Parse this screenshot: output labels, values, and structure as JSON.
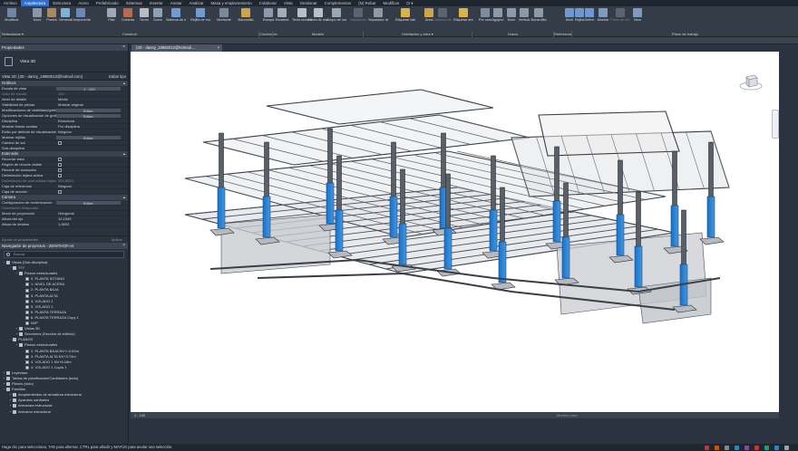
{
  "menu": {
    "tabs": [
      "Archivo",
      "Arquitectura",
      "Estructura",
      "Acero",
      "Prefabricado",
      "Sistemas",
      "Insertar",
      "Anotar",
      "Analizar",
      "Masa y emplazamiento",
      "Colaborar",
      "Vista",
      "Gestionar",
      "Complementos",
      "(N) Rebar",
      "Modificar"
    ],
    "active_index": 1
  },
  "ribbon": {
    "buttons": [
      {
        "label": "Modificar",
        "color": "#6f86a6",
        "dim": false
      },
      {
        "label": "Muro",
        "color": "#8a97a8",
        "dim": false
      },
      {
        "label": "Puerta",
        "color": "#a88a5e",
        "dim": false
      },
      {
        "label": "Ventana",
        "color": "#7fb0d6",
        "dim": false
      },
      {
        "label": "Componente",
        "color": "#6e87b9",
        "dim": false
      },
      {
        "label": "Pilar",
        "color": "#9fa8b6",
        "dim": false
      },
      {
        "label": "Cubierta",
        "color": "#b86b4b",
        "dim": false
      },
      {
        "label": "Techo",
        "color": "#b5bcc6",
        "dim": false
      },
      {
        "label": "Suelo",
        "color": "#8fa0b3",
        "dim": false
      },
      {
        "label": "Sistema de muro cortina",
        "color": "#6f9ad2",
        "dim": false
      },
      {
        "label": "Rejilla de muro cortina",
        "color": "#6f9ad2",
        "dim": false
      },
      {
        "label": "Montante",
        "color": "#7b8899",
        "dim": false
      },
      {
        "label": "Barandilla",
        "color": "#c9a64b",
        "dim": false
      },
      {
        "label": "Rampa",
        "color": "#8c9aab",
        "dim": false
      },
      {
        "label": "Escalera",
        "color": "#a3adb9",
        "dim": false
      },
      {
        "label": "Texto modelado",
        "color": "#b7c0ca",
        "dim": false
      },
      {
        "label": "Línea de modelo",
        "color": "#b7c0ca",
        "dim": false
      },
      {
        "label": "Grupo de modelo",
        "color": "#9aa6b4",
        "dim": false
      },
      {
        "label": "Habitación",
        "color": "#5a6472",
        "dim": true
      },
      {
        "label": "Separador de habitación",
        "color": "#8e9aa8",
        "dim": false
      },
      {
        "label": "Etiquetar habitación",
        "color": "#d7b24d",
        "dim": false
      },
      {
        "label": "Área",
        "color": "#c9a64b",
        "dim": false
      },
      {
        "label": "Contorno de área",
        "color": "#5a6472",
        "dim": true
      },
      {
        "label": "Etiquetar área",
        "color": "#d7b24d",
        "dim": false
      },
      {
        "label": "Por cara",
        "color": "#7c8da2",
        "dim": false
      },
      {
        "label": "Agujero",
        "color": "#8d99a8",
        "dim": false
      },
      {
        "label": "Muro",
        "color": "#8d99a8",
        "dim": false
      },
      {
        "label": "Vertical",
        "color": "#8d99a8",
        "dim": false
      },
      {
        "label": "Buhardilla",
        "color": "#8d99a8",
        "dim": false
      },
      {
        "label": "Nivel",
        "color": "#6e98cf",
        "dim": false
      },
      {
        "label": "Rejilla",
        "color": "#6e98cf",
        "dim": false
      },
      {
        "label": "Definir",
        "color": "#6e98cf",
        "dim": false
      },
      {
        "label": "Mostrar",
        "color": "#7f9ac0",
        "dim": false
      },
      {
        "label": "Plano de ref.",
        "color": "#5a6472",
        "dim": true
      },
      {
        "label": "Visor",
        "color": "#7f9ac0",
        "dim": false
      }
    ],
    "groups": [
      {
        "label": "Construir"
      },
      {
        "label": "Circulación"
      },
      {
        "label": "Modelo"
      },
      {
        "label": "Habitación y área ▾"
      },
      {
        "label": "Hueco"
      },
      {
        "label": "Referencia"
      },
      {
        "label": "Plano de trabajo"
      }
    ],
    "select_label": "Seleccionar ▾"
  },
  "properties": {
    "title": "Propiedades",
    "type_name": "Vista 3D",
    "view_selector": "Vista 3D: {3D - danny_19982012@hotmail.com}",
    "edit_type": "Editar tipo",
    "sections": {
      "graficos": "Gráficos",
      "extension": "Extensión",
      "camara": "Cámara"
    },
    "graficos_rows": [
      {
        "k": "Escala de vista",
        "v": "1 : 100",
        "box": true
      },
      {
        "k": "Valor de escala",
        "v": "100",
        "dim": true
      },
      {
        "k": "Nivel de detalle",
        "v": "Medio"
      },
      {
        "k": "Visibilidad de piezas",
        "v": "Mostrar original"
      },
      {
        "k": "Modificaciones de visibilidad/gráficos",
        "v": "Editar...",
        "box": true
      },
      {
        "k": "Opciones de visualización de gráficos",
        "v": "Editar...",
        "box": true
      },
      {
        "k": "Disciplina",
        "v": "Estructura"
      },
      {
        "k": "Mostrar líneas ocultas",
        "v": "Por disciplina"
      },
      {
        "k": "Estilo por defecto de visualización",
        "v": "Ninguno"
      },
      {
        "k": "Mostrar rejillas",
        "v": "Editar...",
        "box": true
      },
      {
        "k": "Camino de sol",
        "v": "",
        "check": true
      },
      {
        "k": "Sub-disciplina",
        "v": ""
      }
    ],
    "extension_rows": [
      {
        "k": "Recortar vista",
        "v": "",
        "check": true
      },
      {
        "k": "Región de recorte visible",
        "v": "",
        "check": true
      },
      {
        "k": "Recorte de anotación",
        "v": "",
        "check": true
      },
      {
        "k": "Delimitación lejana activa",
        "v": "",
        "check": true
      },
      {
        "k": "Delimitación de profundidad lejana",
        "v": "304,8000",
        "dim": true
      },
      {
        "k": "Caja de referencia",
        "v": "Ninguno"
      },
      {
        "k": "Caja de sección",
        "v": "",
        "check": true
      }
    ],
    "camara_rows": [
      {
        "k": "Configuración de renderización",
        "v": "Editar...",
        "box": true
      },
      {
        "k": "Orientación bloqueada",
        "v": "",
        "dim": true
      },
      {
        "k": "Modo de proyección",
        "v": "Ortogonal"
      },
      {
        "k": "Altura del ojo",
        "v": "12,1549"
      },
      {
        "k": "Altura de destino",
        "v": "1,4693"
      }
    ],
    "help_link": "Ayuda de propiedades",
    "apply": "Aplicar"
  },
  "browser": {
    "title": "Navegador de proyectos - ZENITHOF.rvt",
    "search_placeholder": "Buscar",
    "nodes": [
      {
        "indent": 0,
        "tw": "−",
        "icon": "folder",
        "label": "Vistas (Sub-disciplina)"
      },
      {
        "indent": 1,
        "tw": "−",
        "icon": "folder",
        "label": "???"
      },
      {
        "indent": 2,
        "tw": "−",
        "icon": "folder",
        "label": "Planos estructurales"
      },
      {
        "indent": 3,
        "tw": "",
        "icon": "plan",
        "label": "0. PLANTA SOTANO"
      },
      {
        "indent": 3,
        "tw": "",
        "icon": "plan",
        "label": "1. NIVEL DE ACERA"
      },
      {
        "indent": 3,
        "tw": "",
        "icon": "plan",
        "label": "2. PLANTA BAJA"
      },
      {
        "indent": 3,
        "tw": "",
        "icon": "plan",
        "label": "3. PLANTA ALTA"
      },
      {
        "indent": 3,
        "tw": "",
        "icon": "plan",
        "label": "4. VOLADO 1"
      },
      {
        "indent": 3,
        "tw": "",
        "icon": "plan",
        "label": "5. VOLADO 2"
      },
      {
        "indent": 3,
        "tw": "",
        "icon": "plan",
        "label": "6. PLANTA TERRAZA"
      },
      {
        "indent": 3,
        "tw": "",
        "icon": "plan",
        "label": "6. PLANTA TERRAZA Copy 1"
      },
      {
        "indent": 3,
        "tw": "",
        "icon": "plan",
        "label": "N2P"
      },
      {
        "indent": 2,
        "tw": "+",
        "icon": "folder",
        "label": "Vistas 3D"
      },
      {
        "indent": 2,
        "tw": "+",
        "icon": "folder",
        "label": "Secciones (Sección de edificio)"
      },
      {
        "indent": 1,
        "tw": "−",
        "icon": "folder",
        "label": "PLANOS"
      },
      {
        "indent": 2,
        "tw": "−",
        "icon": "folder",
        "label": "Planos estructurales"
      },
      {
        "indent": 3,
        "tw": "",
        "icon": "plan",
        "label": "2. PLANTA BAJA NV+/-0.00m"
      },
      {
        "indent": 3,
        "tw": "",
        "icon": "plan",
        "label": "3. PLANTA ALTA NV+3.74m"
      },
      {
        "indent": 3,
        "tw": "",
        "icon": "plan",
        "label": "4. VOLADO 1 NV+6.18m"
      },
      {
        "indent": 3,
        "tw": "",
        "icon": "plan",
        "label": "4. VOLADO 1 Copia 1"
      },
      {
        "indent": 0,
        "tw": "+",
        "icon": "folder",
        "label": "Leyendas"
      },
      {
        "indent": 0,
        "tw": "+",
        "icon": "folder",
        "label": "Tablas de planificación/Cantidades (todo)"
      },
      {
        "indent": 0,
        "tw": "+",
        "icon": "folder",
        "label": "Planos (todo)"
      },
      {
        "indent": 0,
        "tw": "−",
        "icon": "folder",
        "label": "Familias"
      },
      {
        "indent": 1,
        "tw": "+",
        "icon": "folder",
        "label": "Acoplamientos de armadura estructural"
      },
      {
        "indent": 1,
        "tw": "+",
        "icon": "folder",
        "label": "Aparatos sanitarios"
      },
      {
        "indent": 1,
        "tw": "+",
        "icon": "folder",
        "label": "Armadura estructural"
      },
      {
        "indent": 1,
        "tw": "+",
        "icon": "folder",
        "label": "Armazón estructural"
      }
    ]
  },
  "view": {
    "tab_label": "{3D - danny_19982012@hotmail....",
    "scale": "1 : 100",
    "model_label": "Modelo base"
  },
  "status": {
    "text": "Haga clic para seleccionar, TAB para alternar, CTRL para añadir y MAYÚS para anular una selección.",
    "icon_colors": [
      "#c0392b",
      "#d35400",
      "#7f8c8d",
      "#2e86c1",
      "#8e44ad",
      "#c0392b",
      "#16a085",
      "#2e86c1",
      "#95a5a6"
    ]
  }
}
